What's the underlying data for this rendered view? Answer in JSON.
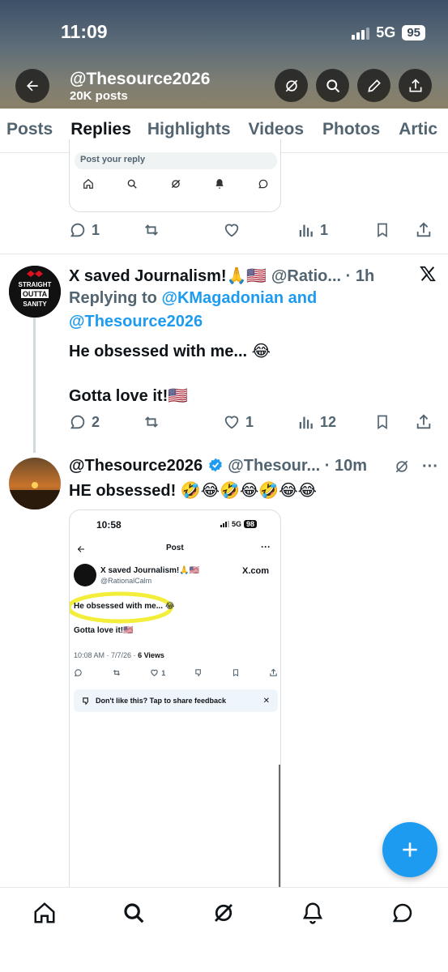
{
  "status_bar": {
    "time": "11:09",
    "network": "5G",
    "battery": "95"
  },
  "profile_header": {
    "name": "@Thesource2026",
    "posts": "20K posts"
  },
  "tabs": [
    "Posts",
    "Replies",
    "Highlights",
    "Videos",
    "Photos",
    "Artic"
  ],
  "top_card": {
    "reply_placeholder": "Post your reply",
    "replies": "1",
    "views": "1"
  },
  "tweet1": {
    "name": "X saved Journalism!🙏🇺🇸",
    "handle": "@Ratio...",
    "time": "· 1h",
    "replying_prefix": "Replying to",
    "replying_to_1": "@KMagadonian and",
    "replying_to_2": "@Thesource2026",
    "line1": "He obsessed with me... 😂",
    "line2": "Gotta love it!🇺🇸",
    "replies": "2",
    "likes": "1",
    "views": "12",
    "avatar_line1": "STRAIGHT",
    "avatar_line2": "OUTTA",
    "avatar_line3": "SANITY"
  },
  "tweet2": {
    "name": "@Thesource2026",
    "handle": "@Thesour...",
    "time": "· 10m",
    "text": "HE obsessed! 🤣😂🤣😂🤣😂😂"
  },
  "embedded_screenshot": {
    "time": "10:58",
    "network": "5G",
    "battery": "98",
    "header": "Post",
    "name": "X saved Journalism!🙏🇺🇸",
    "handle": "@RationalCalm",
    "xcom": "X.com",
    "line1": "He obsessed with me... 😂",
    "line2": "Gotta love it!🇺🇸",
    "meta_date": "10:08 AM · 7/7/26 ·",
    "meta_views": "6 Views",
    "likes": "1",
    "feedback": "Don't like this? Tap to share feedback"
  },
  "colors": {
    "accent": "#1d9bf0",
    "text": "#0f1419",
    "secondary": "#536471",
    "highlight": "#f2ee3a"
  }
}
